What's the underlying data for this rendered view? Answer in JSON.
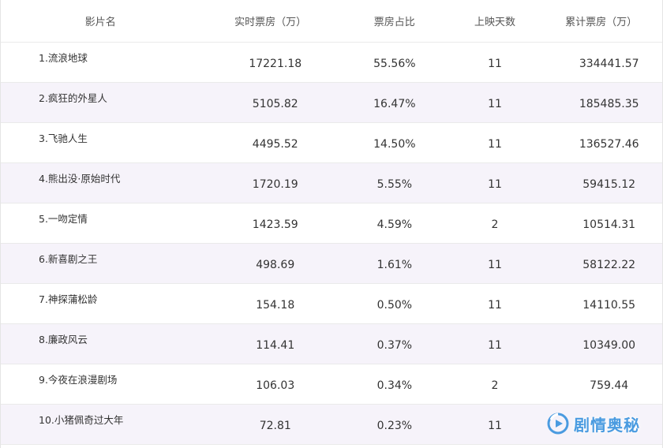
{
  "table": {
    "headers": [
      "影片名",
      "实时票房（万）",
      "票房占比",
      "上映天数",
      "累计票房（万）"
    ],
    "rows": [
      {
        "name": "1.流浪地球",
        "realtime": "17221.18",
        "share": "55.56%",
        "days": "11",
        "total": "334441.57"
      },
      {
        "name": "2.疯狂的外星人",
        "realtime": "5105.82",
        "share": "16.47%",
        "days": "11",
        "total": "185485.35"
      },
      {
        "name": "3.飞驰人生",
        "realtime": "4495.52",
        "share": "14.50%",
        "days": "11",
        "total": "136527.46"
      },
      {
        "name": "4.熊出没·原始时代",
        "realtime": "1720.19",
        "share": "5.55%",
        "days": "11",
        "total": "59415.12"
      },
      {
        "name": "5.一吻定情",
        "realtime": "1423.59",
        "share": "4.59%",
        "days": "2",
        "total": "10514.31"
      },
      {
        "name": "6.新喜剧之王",
        "realtime": "498.69",
        "share": "1.61%",
        "days": "11",
        "total": "58122.22"
      },
      {
        "name": "7.神探蒲松龄",
        "realtime": "154.18",
        "share": "0.50%",
        "days": "11",
        "total": "14110.55"
      },
      {
        "name": "8.廉政风云",
        "realtime": "114.41",
        "share": "0.37%",
        "days": "11",
        "total": "10349.00"
      },
      {
        "name": "9.今夜在浪漫剧场",
        "realtime": "106.03",
        "share": "0.34%",
        "days": "2",
        "total": "759.44"
      },
      {
        "name": "10.小猪佩奇过大年",
        "realtime": "72.81",
        "share": "0.23%",
        "days": "11",
        "total": ""
      }
    ]
  },
  "watermark": {
    "text": "剧情奥秘",
    "icon": "play-logo-icon",
    "color": "#4a9be0"
  },
  "colors": {
    "alt_row": "#f6f3fa",
    "border": "#eaeaea"
  }
}
